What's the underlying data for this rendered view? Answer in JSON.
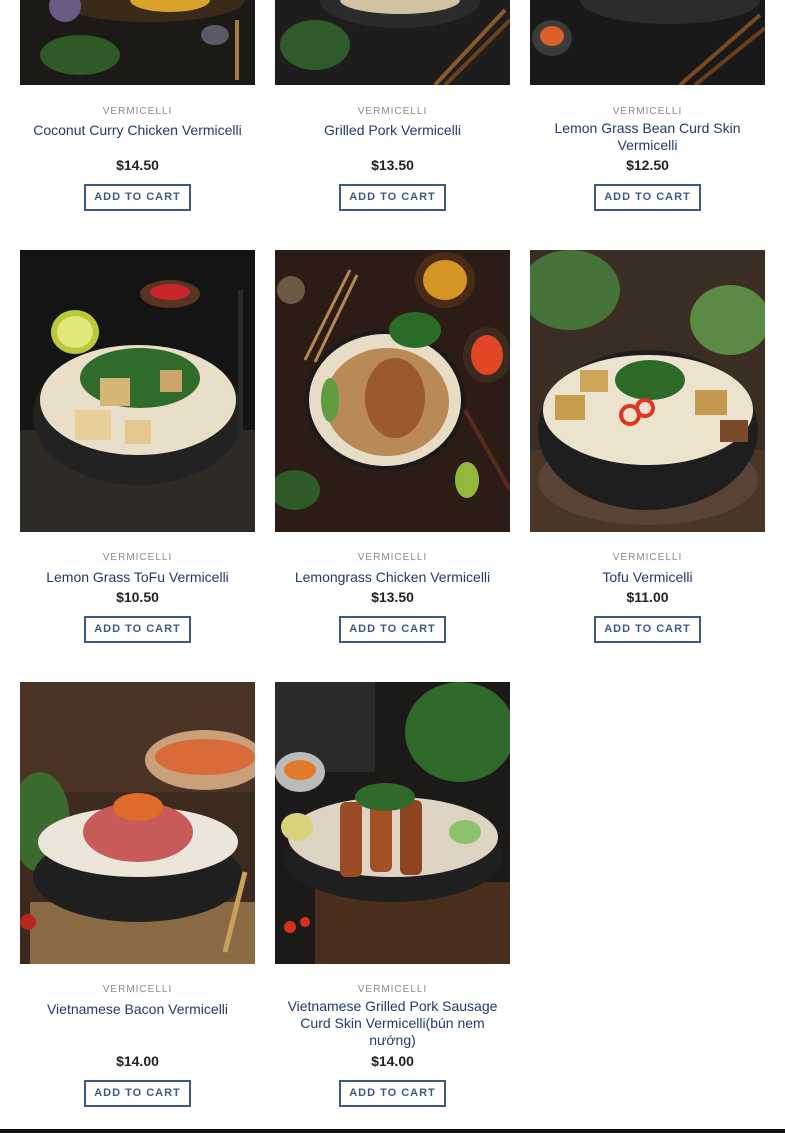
{
  "products": [
    {
      "category": "VERMICELLI",
      "title": "Coconut Curry Chicken Vermicelli",
      "price": "$14.50",
      "button": "ADD TO CART"
    },
    {
      "category": "VERMICELLI",
      "title": "Grilled Pork Vermicelli",
      "price": "$13.50",
      "button": "ADD TO CART"
    },
    {
      "category": "VERMICELLI",
      "title": "Lemon Grass Bean Curd Skin Vermicelli",
      "price": "$12.50",
      "button": "ADD TO CART"
    },
    {
      "category": "VERMICELLI",
      "title": "Lemon Grass ToFu Vermicelli",
      "price": "$10.50",
      "button": "ADD TO CART"
    },
    {
      "category": "VERMICELLI",
      "title": "Lemongrass Chicken Vermicelli",
      "price": "$13.50",
      "button": "ADD TO CART"
    },
    {
      "category": "VERMICELLI",
      "title": "Tofu Vermicelli",
      "price": "$11.00",
      "button": "ADD TO CART"
    },
    {
      "category": "VERMICELLI",
      "title": "Vietnamese Bacon Vermicelli",
      "price": "$14.00",
      "button": "ADD TO CART"
    },
    {
      "category": "VERMICELLI",
      "title": "Vietnamese Grilled Pork Sausage Curd Skin Vermicelli(bún nem nướng)",
      "price": "$14.00",
      "button": "ADD TO CART"
    }
  ],
  "colors": {
    "link": "#1f3b6e",
    "button_border": "#3b5a8a",
    "category": "#8a8a8a"
  }
}
